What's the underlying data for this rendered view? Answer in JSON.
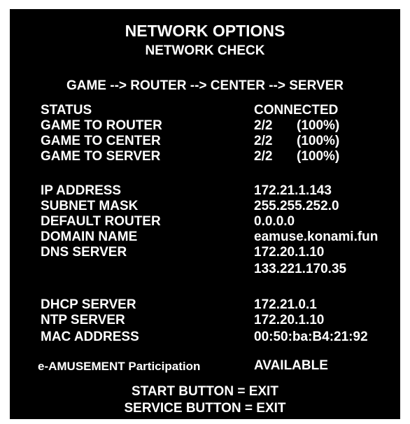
{
  "header": {
    "title": "NETWORK OPTIONS",
    "subtitle": "NETWORK CHECK",
    "route": "GAME --> ROUTER --> CENTER --> SERVER"
  },
  "connection": {
    "status_label": "STATUS",
    "status_value": "CONNECTED",
    "tests": [
      {
        "label": "GAME TO ROUTER",
        "count": "2/2",
        "percent": "(100%)"
      },
      {
        "label": "GAME TO CENTER",
        "count": "2/2",
        "percent": "(100%)"
      },
      {
        "label": "GAME TO SERVER",
        "count": "2/2",
        "percent": "(100%)"
      }
    ]
  },
  "network": [
    {
      "label": "IP ADDRESS",
      "value": "172.21.1.143"
    },
    {
      "label": "SUBNET MASK",
      "value": "255.255.252.0"
    },
    {
      "label": "DEFAULT ROUTER",
      "value": "0.0.0.0"
    },
    {
      "label": "DOMAIN NAME",
      "value": "eamuse.konami.fun"
    },
    {
      "label": "DNS SERVER",
      "value": "172.20.1.10"
    },
    {
      "label": "",
      "value": "133.221.170.35"
    }
  ],
  "servers": [
    {
      "label": "DHCP SERVER",
      "value": "172.21.0.1"
    },
    {
      "label": "NTP SERVER",
      "value": "172.20.1.10"
    },
    {
      "label": "MAC ADDRESS",
      "value": "00:50:ba:B4:21:92"
    }
  ],
  "participation": {
    "label": "e-AMUSEMENT Participation",
    "value": "AVAILABLE"
  },
  "footer": {
    "start": "START BUTTON = EXIT",
    "service": "SERVICE BUTTON = EXIT"
  },
  "colors": {
    "background": "#000000",
    "text": "#ffffff",
    "border": "#ffffff"
  }
}
